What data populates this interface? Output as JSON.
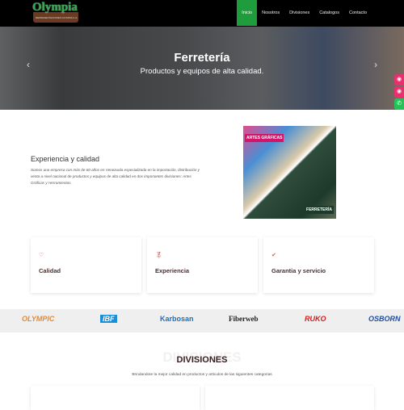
{
  "header": {
    "logo_text": "Olympia",
    "logo_sub": "REPRESENTACIONES OLYMPIA C.A.",
    "nav": [
      {
        "label": "Inicio",
        "active": true
      },
      {
        "label": "Nosotros"
      },
      {
        "label": "Divisiones"
      },
      {
        "label": "Catalogos"
      },
      {
        "label": "Contacto"
      }
    ],
    "active_color": "#1f9d3c"
  },
  "hero": {
    "title": "Ferretería",
    "subtitle": "Productos y equipos de alta calidad.",
    "prev_icon": "chevron-left",
    "next_icon": "chevron-right"
  },
  "social": [
    {
      "icon": "instagram-icon",
      "color": "#e8306f"
    },
    {
      "icon": "instagram-icon",
      "color": "#e8306f"
    },
    {
      "icon": "whatsapp-icon",
      "color": "#25c25a"
    }
  ],
  "about": {
    "title": "Experiencia y calidad",
    "text": "Somos una empresa con más de 60 años en Venezuela especializada en la importación, distribución y venta a nivel nacional de productos y equipos de alta calidad en dos importantes divisiones: Artes Gráficas y Herramientas.",
    "image_label_top": "ARTES GRÁFICAS",
    "image_label_bottom": "FERRETERÍA"
  },
  "features": [
    {
      "icon": "heart-icon",
      "title": "Calidad"
    },
    {
      "icon": "medal-icon",
      "title": "Experiencia"
    },
    {
      "icon": "shield-check-icon",
      "title": "Garantia y servicio"
    }
  ],
  "brands": [
    "OLYMPIC",
    "IBF",
    "Karbosan",
    "Fiberweb",
    "RUKO",
    "OSBORN"
  ],
  "divisions": {
    "watermark": "DIVISIONES",
    "title": "DIVISIONES",
    "subtitle": "Brindandote la mejor calidad en productos y articulos de las siguientes categorias"
  }
}
